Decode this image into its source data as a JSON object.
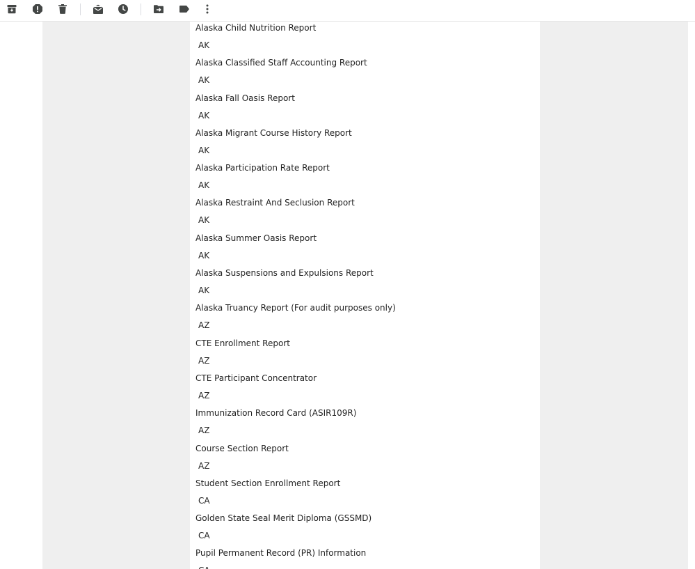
{
  "toolbar": {
    "buttons": [
      {
        "name": "archive-icon",
        "label": "Archive"
      },
      {
        "name": "report-spam-icon",
        "label": "Report spam"
      },
      {
        "name": "delete-icon",
        "label": "Delete"
      },
      {
        "name": "mark-as-read-icon",
        "label": "Mark as read"
      },
      {
        "name": "snooze-icon",
        "label": "Snooze"
      },
      {
        "name": "move-to-icon",
        "label": "Move to"
      },
      {
        "name": "label-icon",
        "label": "Labels"
      },
      {
        "name": "more-options-icon",
        "label": "More"
      }
    ],
    "icon_color": "#444746"
  },
  "reports": [
    {
      "title": "Alaska Child Nutrition Report",
      "state": "AK"
    },
    {
      "title": "Alaska Classified Staff Accounting Report",
      "state": "AK"
    },
    {
      "title": "Alaska Fall Oasis Report",
      "state": "AK"
    },
    {
      "title": "Alaska Migrant Course History Report",
      "state": "AK"
    },
    {
      "title": "Alaska Participation Rate Report",
      "state": "AK"
    },
    {
      "title": "Alaska Restraint And Seclusion Report",
      "state": "AK"
    },
    {
      "title": "Alaska Summer Oasis Report",
      "state": "AK"
    },
    {
      "title": "Alaska Suspensions and Expulsions Report",
      "state": "AK"
    },
    {
      "title": "Alaska Truancy Report (For audit purposes only)",
      "state": "AZ"
    },
    {
      "title": "CTE Enrollment Report",
      "state": "AZ"
    },
    {
      "title": "CTE Participant Concentrator",
      "state": "AZ"
    },
    {
      "title": "Immunization Record Card (ASIR109R)",
      "state": "AZ"
    },
    {
      "title": "Course Section Report",
      "state": "AZ"
    },
    {
      "title": "Student Section Enrollment Report",
      "state": "CA"
    },
    {
      "title": "Golden State Seal Merit Diploma (GSSMD)",
      "state": "CA"
    },
    {
      "title": "Pupil Permanent Record (PR) Information",
      "state": "CA"
    }
  ]
}
